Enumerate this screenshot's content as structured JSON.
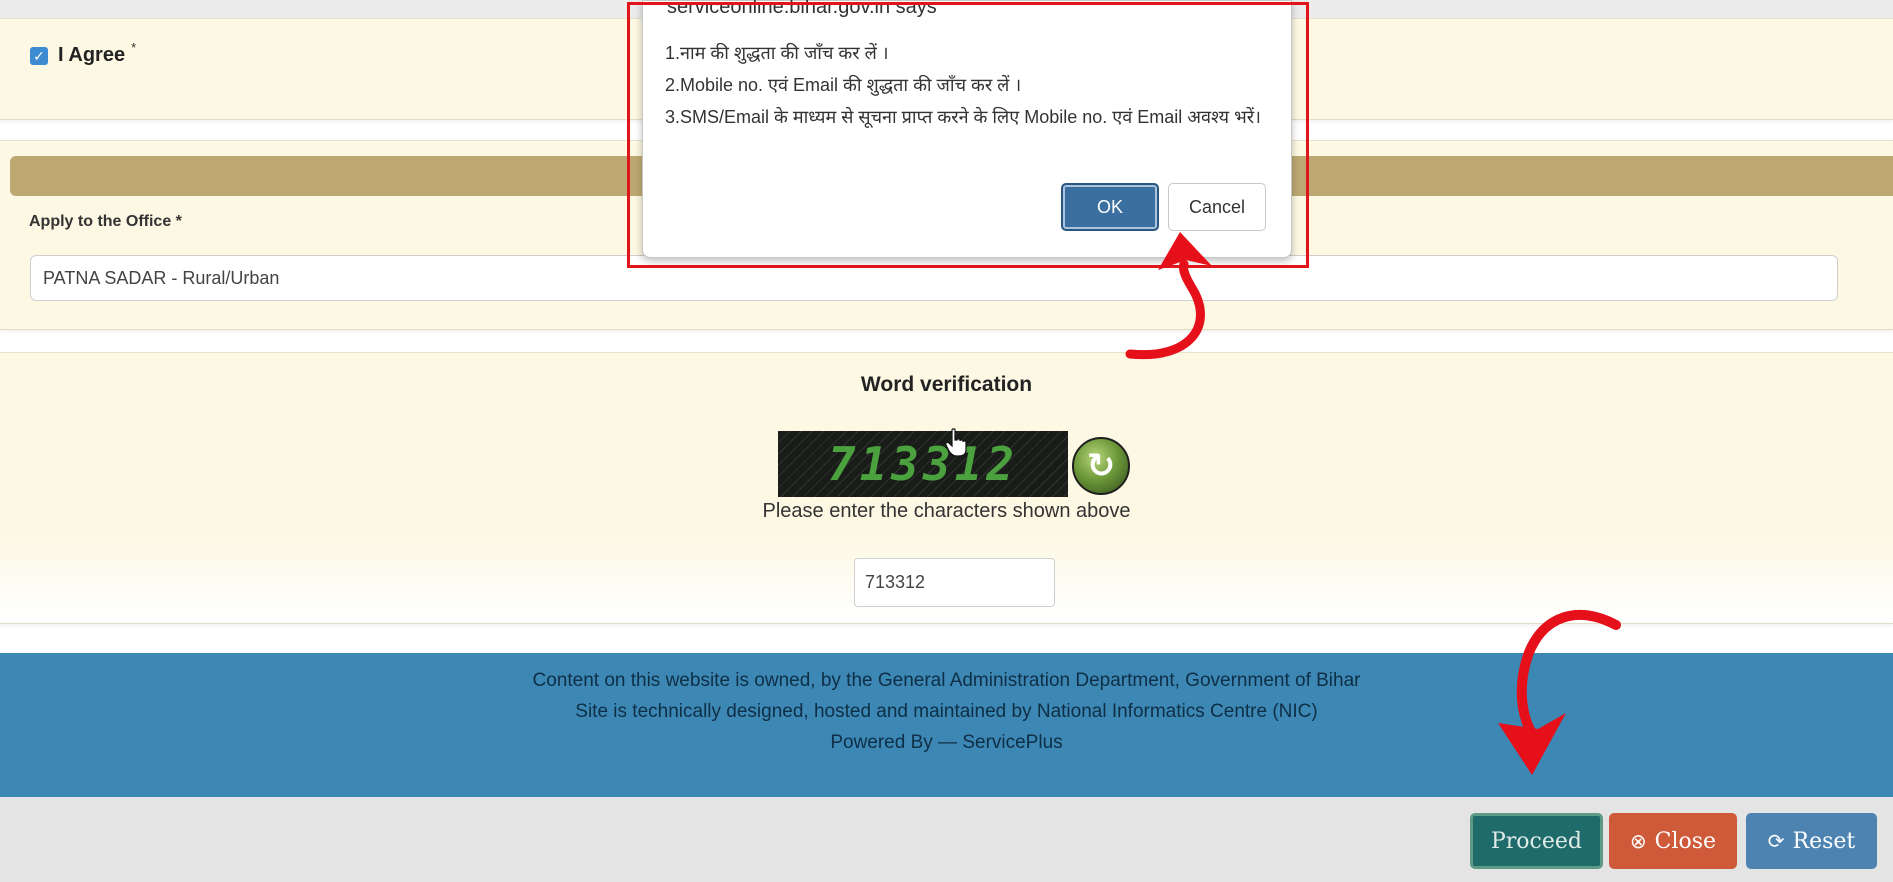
{
  "agreement": {
    "label": "I Agree",
    "required_mark": "*"
  },
  "office": {
    "label": "Apply to the Office *",
    "selected": "PATNA SADAR - Rural/Urban"
  },
  "verification": {
    "title": "Word verification",
    "captcha_text": "713312",
    "hint": "Please enter the characters shown above",
    "input_value": "713312"
  },
  "footer": {
    "line1": "Content on this website is owned, by the General Administration Department, Government of Bihar",
    "line2": "Site is technically designed, hosted and maintained by National Informatics Centre (NIC)",
    "line3": "Powered By — ServicePlus"
  },
  "actions": {
    "proceed": "Proceed",
    "close": "Close",
    "reset": "Reset"
  },
  "dialog": {
    "title": "serviceonline.bihar.gov.in says",
    "line1": "1.नाम की शुद्धता की जाँच कर लें ।",
    "line2": "2.Mobile no. एवं Email की शुद्धता की जाँच कर लें ।",
    "line3": "3.SMS/Email के माध्यम से सूचना प्राप्त करने के लिए Mobile no. एवं  Email अवश्य भरें।",
    "ok": "OK",
    "cancel": "Cancel"
  },
  "colors": {
    "highlight": "#e0141b",
    "footer_bg": "#3d87b4",
    "proceed_bg": "#1f6a6a",
    "close_bg": "#cf5a3a",
    "reset_bg": "#4c83b0"
  },
  "icons": {
    "checkbox": "checkbox-checked-icon",
    "refresh": "refresh-captcha-icon",
    "close": "close-circle-icon",
    "reset": "reset-icon"
  }
}
